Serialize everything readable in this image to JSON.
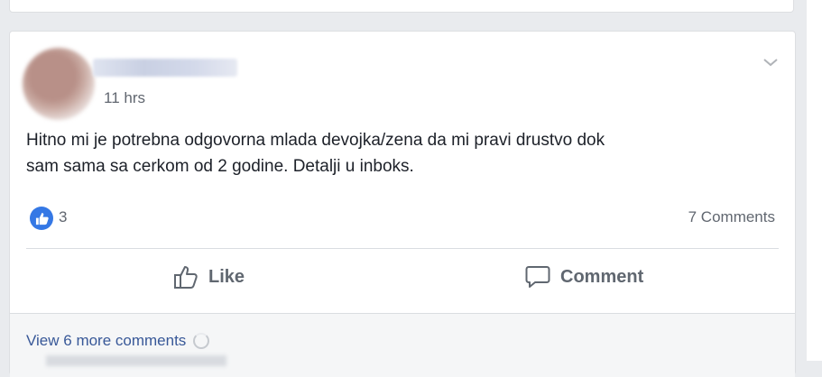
{
  "post": {
    "timestamp": "11 hrs",
    "text_line1": "Hitno mi je potrebna odgovorna mlada devojka/zena da mi pravi drustvo dok",
    "text_line2": "sam sama sa cerkom od 2 godine. Detalji u inboks.",
    "reactions": {
      "icon": "thumbs-up-icon",
      "color": "#3578e5",
      "count": "3"
    },
    "comments_count_label": "7 Comments",
    "actions": {
      "like_label": "Like",
      "comment_label": "Comment"
    },
    "view_more_label": "View 6 more comments"
  },
  "colors": {
    "page_bg": "#e9ebee",
    "card_bg": "#ffffff",
    "text": "#1d2129",
    "muted": "#616770",
    "link": "#385898"
  }
}
